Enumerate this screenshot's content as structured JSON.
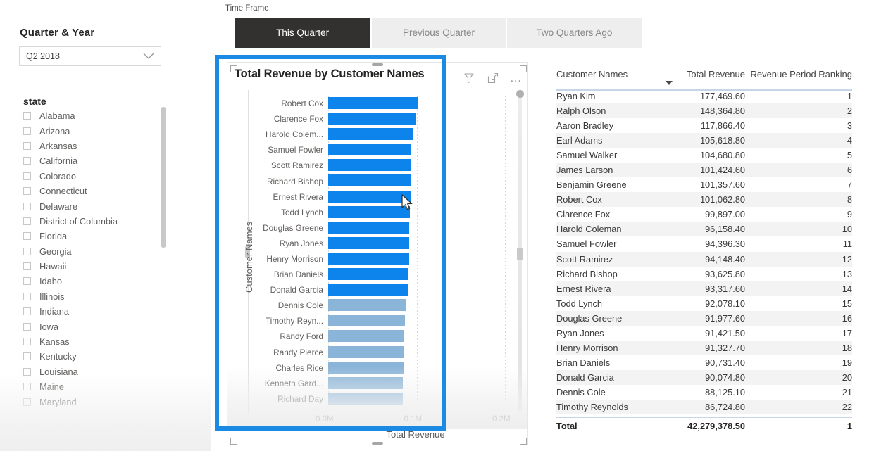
{
  "sidebar": {
    "quarter_year_label": "Quarter & Year",
    "quarter_year_value": "Q2 2018",
    "state_label": "state",
    "states": [
      "Alabama",
      "Arizona",
      "Arkansas",
      "California",
      "Colorado",
      "Connecticut",
      "Delaware",
      "District of Columbia",
      "Florida",
      "Georgia",
      "Hawaii",
      "Idaho",
      "Illinois",
      "Indiana",
      "Iowa",
      "Kansas",
      "Kentucky",
      "Louisiana",
      "Maine",
      "Maryland"
    ]
  },
  "timeframe": {
    "label": "Time Frame",
    "tabs": [
      {
        "label": "This Quarter",
        "selected": true
      },
      {
        "label": "Previous Quarter",
        "selected": false
      },
      {
        "label": "Two Quarters Ago",
        "selected": false
      }
    ]
  },
  "chart_card": {
    "title": "Total Revenue by Customer Names",
    "icons": [
      "filter-icon",
      "focus-mode-icon",
      "more-options-icon"
    ],
    "more_glyph": "…"
  },
  "chart_data": {
    "type": "bar",
    "orientation": "horizontal",
    "title": "Total Revenue by Customer Names",
    "xlabel": "Total Revenue",
    "ylabel": "Customer Names",
    "xlim": [
      0,
      200000
    ],
    "xticks": [
      0,
      100000,
      200000
    ],
    "xtick_labels": [
      "0.0M",
      "0.1M",
      "0.2M"
    ],
    "grid": true,
    "legend": "none",
    "highlight_color": "#0d84ec",
    "muted_color": "#8ab4d8",
    "categories": [
      "Robert Cox",
      "Clarence Fox",
      "Harold Colem...",
      "Samuel Fowler",
      "Scott Ramirez",
      "Richard Bishop",
      "Ernest Rivera",
      "Todd Lynch",
      "Douglas Greene",
      "Ryan Jones",
      "Henry Morrison",
      "Brian Daniels",
      "Donald Garcia",
      "Dennis Cole",
      "Timothy Reyn...",
      "Randy Ford",
      "Randy Pierce",
      "Charles Rice",
      "Kenneth Gard...",
      "Richard Day"
    ],
    "values": [
      101062.8,
      99897.0,
      96158.4,
      94396.3,
      94148.4,
      93625.8,
      93317.6,
      92078.1,
      91977.6,
      91421.5,
      91327.7,
      90731.4,
      90074.8,
      88125.1,
      86724.8,
      86000.0,
      85500.0,
      85000.0,
      84600.0,
      84200.0
    ],
    "muted_from_index": 13
  },
  "table": {
    "columns": [
      "Customer Names",
      "Total Revenue",
      "Revenue Period Ranking"
    ],
    "sorted_column": "Total Revenue",
    "sort_direction": "descending",
    "rows": [
      {
        "name": "Ryan Kim",
        "revenue": "177,469.60",
        "rank": "1"
      },
      {
        "name": "Ralph Olson",
        "revenue": "148,364.80",
        "rank": "2"
      },
      {
        "name": "Aaron Bradley",
        "revenue": "117,866.40",
        "rank": "3"
      },
      {
        "name": "Earl Adams",
        "revenue": "105,618.80",
        "rank": "4"
      },
      {
        "name": "Samuel Walker",
        "revenue": "104,680.80",
        "rank": "5"
      },
      {
        "name": "James Larson",
        "revenue": "101,424.60",
        "rank": "6"
      },
      {
        "name": "Benjamin Greene",
        "revenue": "101,357.60",
        "rank": "7"
      },
      {
        "name": "Robert Cox",
        "revenue": "101,062.80",
        "rank": "8"
      },
      {
        "name": "Clarence Fox",
        "revenue": "99,897.00",
        "rank": "9"
      },
      {
        "name": "Harold Coleman",
        "revenue": "96,158.40",
        "rank": "10"
      },
      {
        "name": "Samuel Fowler",
        "revenue": "94,396.30",
        "rank": "11"
      },
      {
        "name": "Scott Ramirez",
        "revenue": "94,148.40",
        "rank": "12"
      },
      {
        "name": "Richard Bishop",
        "revenue": "93,625.80",
        "rank": "13"
      },
      {
        "name": "Ernest Rivera",
        "revenue": "93,317.60",
        "rank": "14"
      },
      {
        "name": "Todd Lynch",
        "revenue": "92,078.10",
        "rank": "15"
      },
      {
        "name": "Douglas Greene",
        "revenue": "91,977.60",
        "rank": "16"
      },
      {
        "name": "Ryan Jones",
        "revenue": "91,421.50",
        "rank": "17"
      },
      {
        "name": "Henry Morrison",
        "revenue": "91,327.70",
        "rank": "18"
      },
      {
        "name": "Brian Daniels",
        "revenue": "90,731.40",
        "rank": "19"
      },
      {
        "name": "Donald Garcia",
        "revenue": "90,074.80",
        "rank": "20"
      },
      {
        "name": "Dennis Cole",
        "revenue": "88,125.10",
        "rank": "21"
      },
      {
        "name": "Timothy Reynolds",
        "revenue": "86,724.80",
        "rank": "22"
      }
    ],
    "total": {
      "name": "Total",
      "revenue": "42,279,378.50",
      "rank": "1"
    }
  }
}
